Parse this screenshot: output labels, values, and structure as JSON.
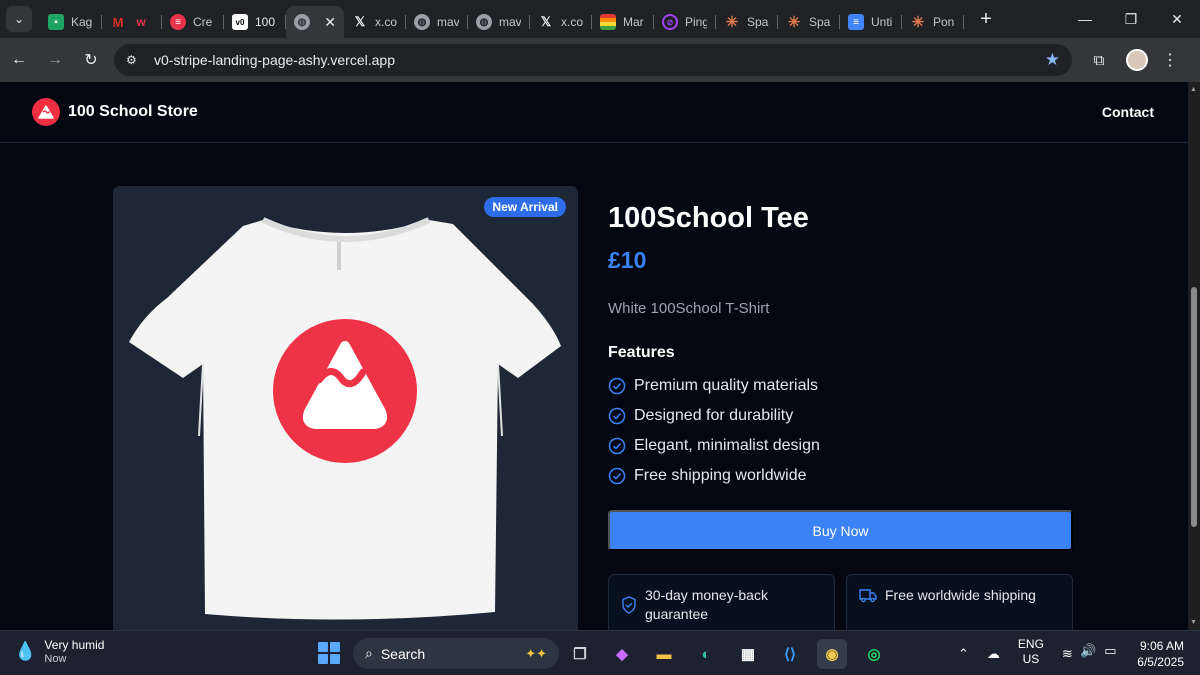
{
  "browser": {
    "tabs": [
      {
        "title": "Kag",
        "favicon": "chat-icon",
        "color": "#1ea362"
      },
      {
        "title": "",
        "favicon": "gmail-icon",
        "color": "#d93025"
      },
      {
        "title": "Cre",
        "favicon": "cre-icon",
        "color": "#e8334a"
      },
      {
        "title": "100",
        "favicon": "v0-icon",
        "color": "#ffffff",
        "active": true
      },
      {
        "title": "",
        "favicon": "globe-icon",
        "color": "#9aa0a6",
        "active": true
      },
      {
        "title": "x.co",
        "favicon": "x-icon",
        "color": "#000000"
      },
      {
        "title": "mav",
        "favicon": "globe-icon",
        "color": "#9aa0a6"
      },
      {
        "title": "mav",
        "favicon": "globe-icon",
        "color": "#9aa0a6"
      },
      {
        "title": "x.co",
        "favicon": "x-icon",
        "color": "#000000"
      },
      {
        "title": "Mar",
        "favicon": "rainbow-icon",
        "color": "#ffb300"
      },
      {
        "title": "Ping",
        "favicon": "ping-icon",
        "color": "#a142f4"
      },
      {
        "title": "Spa",
        "favicon": "claude-icon",
        "color": "#e07a4e"
      },
      {
        "title": "Spa",
        "favicon": "claude-icon",
        "color": "#e07a4e"
      },
      {
        "title": "Unti",
        "favicon": "docs-icon",
        "color": "#4285f4"
      },
      {
        "title": "Pon",
        "favicon": "claude-icon",
        "color": "#e07a4e"
      }
    ],
    "url": "v0-stripe-landing-page-ashy.vercel.app"
  },
  "site": {
    "brand": "100 School Store",
    "nav_contact": "Contact",
    "accent": "#3b82f6",
    "logo_color": "#ef2f41"
  },
  "product": {
    "badge": "New Arrival",
    "title": "100School Tee",
    "price": "£10",
    "description": "White 100School T-Shirt",
    "features_heading": "Features",
    "features": [
      "Premium quality materials",
      "Designed for durability",
      "Elegant, minimalist design",
      "Free shipping worldwide"
    ],
    "buy_label": "Buy Now",
    "guarantees": [
      {
        "icon": "shield-icon",
        "text": "30-day money-back guarantee"
      },
      {
        "icon": "truck-icon",
        "text": "Free worldwide shipping"
      }
    ]
  },
  "taskbar": {
    "weather_title": "Very humid",
    "weather_sub": "Now",
    "search_placeholder": "Search",
    "lang_1": "ENG",
    "lang_2": "US",
    "time": "9:06 AM",
    "date": "6/5/2025"
  }
}
